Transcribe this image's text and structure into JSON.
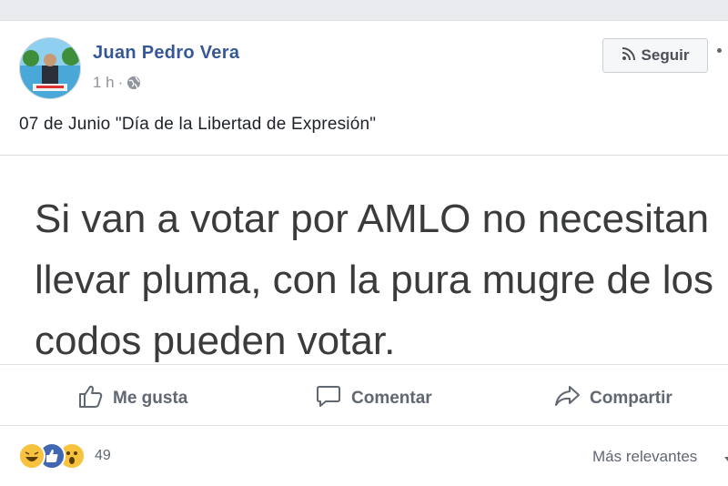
{
  "post": {
    "author": "Juan Pedro Vera",
    "time": "1 h",
    "separator": "·",
    "follow_label": "Seguir",
    "caption": "07 de Junio \"Día de la Libertad de Expresión\"",
    "text_lines": [
      "Si van a votar por AMLO no necesitan",
      "llevar pluma, con la pura mugre de los",
      "codos pueden votar."
    ]
  },
  "actions": {
    "like": "Me gusta",
    "comment": "Comentar",
    "share": "Compartir"
  },
  "reactions": {
    "icons": [
      "haha-icon",
      "like-icon",
      "wow-icon"
    ],
    "count": "49"
  },
  "sort": {
    "label": "Más relevantes"
  },
  "colors": {
    "link": "#365899",
    "like_blue": "#4267b2",
    "reaction_yellow": "#f7c23d"
  }
}
